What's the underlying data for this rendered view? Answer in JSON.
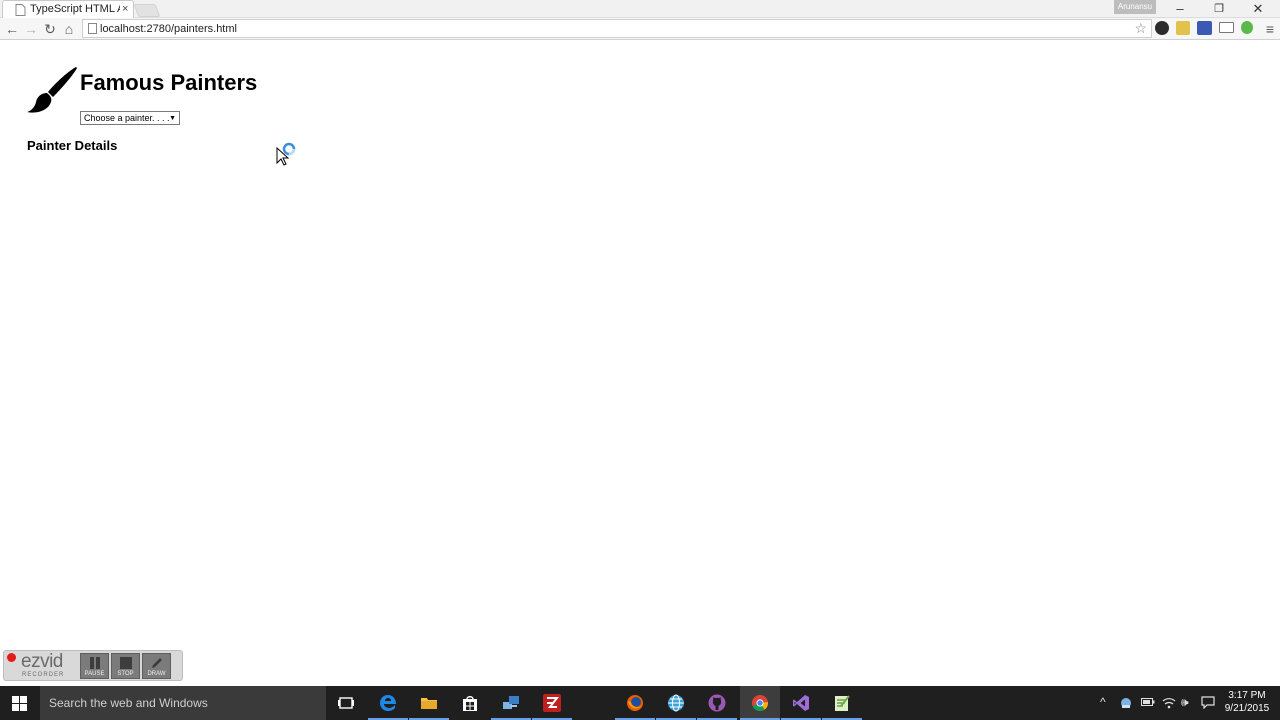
{
  "browser": {
    "tab_title": "TypeScript HTML App",
    "tab_close": "×",
    "user_badge": "Arunansu",
    "window_controls": {
      "minimize": "–",
      "restore": "❐",
      "close": "✕"
    },
    "url": "localhost:2780/painters.html",
    "nav": {
      "back": "←",
      "forward": "→",
      "reload": "↻",
      "home": "⌂"
    },
    "bookmark_star": "☆",
    "menu": "≡"
  },
  "page": {
    "title": "Famous Painters",
    "painter_select": {
      "selected": "Choose a painter. . . .",
      "arrow": "▼"
    },
    "section_title": "Painter Details"
  },
  "recorder": {
    "logo": "ezvid",
    "sub": "RECORDER",
    "buttons": [
      {
        "label": "PAUSE"
      },
      {
        "label": "STOP"
      },
      {
        "label": "DRAW"
      }
    ]
  },
  "taskbar": {
    "search_placeholder": "Search the web and Windows",
    "apps": [
      "task-view",
      "edge",
      "file-explorer",
      "store",
      "remote-desktop",
      "filezilla",
      "firefox",
      "network",
      "github",
      "chrome",
      "visual-studio",
      "notepad"
    ],
    "tray": {
      "chevron": "^",
      "speaker": "🕪"
    },
    "time": "3:17 PM",
    "date": "9/21/2015"
  },
  "colors": {
    "accent": "#6aa0e8",
    "recorder_dot": "#e41b1b",
    "taskbar_bg": "#1f1f1f"
  }
}
